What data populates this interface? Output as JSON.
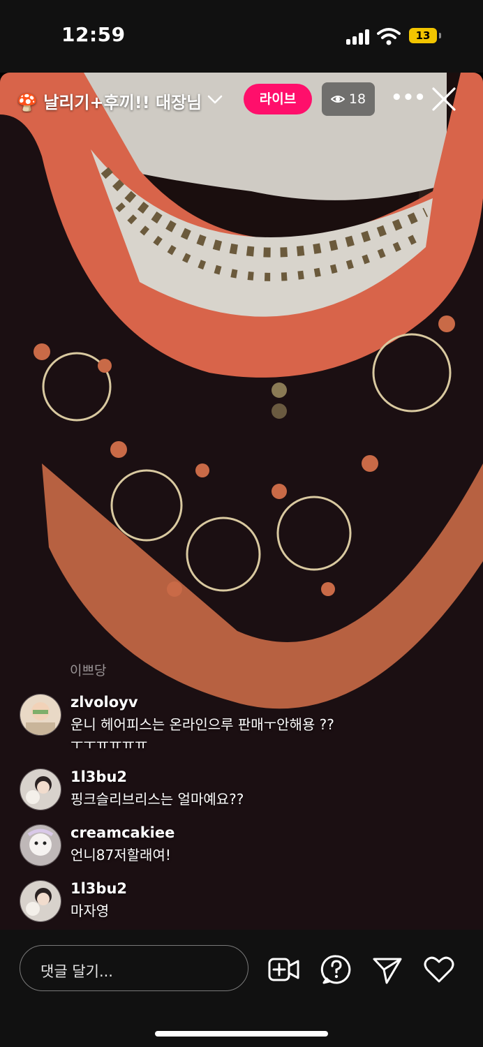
{
  "status_bar": {
    "time": "12:59",
    "battery": "13"
  },
  "live": {
    "title": "🍄 날리기+후끼!! 대장님",
    "badge": "라이브",
    "viewers": "18"
  },
  "comments_section_label": "이쁘당",
  "comments": [
    {
      "user": "zlvoloyv",
      "text": "운니 헤어피스는 온라인으루 판매ㅜ안해용 ??ㅜㅜㅠㅠㅠㅠ"
    },
    {
      "user": "1l3bu2",
      "text": "핑크슬리브리스는 얼마예요??"
    },
    {
      "user": "creamcakiee",
      "text": "언니87저할래여!"
    },
    {
      "user": "1l3bu2",
      "text": "마자영"
    }
  ],
  "input": {
    "placeholder": "댓글 달기..."
  },
  "colors": {
    "live_badge": "#ff0f6b",
    "background": "#111111"
  },
  "icons": [
    "add-video-icon",
    "question-icon",
    "send-icon",
    "heart-icon",
    "close-icon",
    "more-icon",
    "eye-icon"
  ]
}
